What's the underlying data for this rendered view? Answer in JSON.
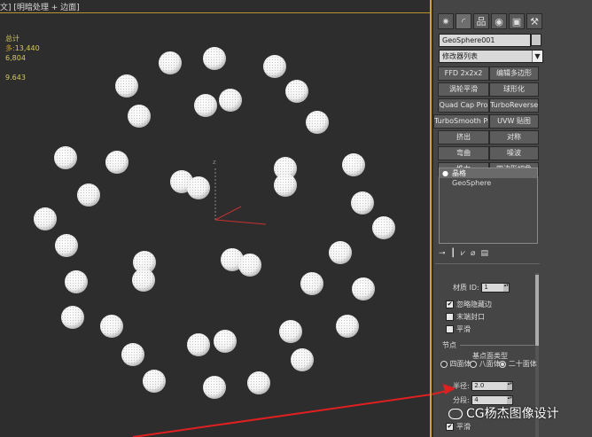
{
  "viewport": {
    "label": "文] [明暗处理 + 边面]",
    "stats_title": "总计",
    "stats_rows": [
      {
        "label": "多:",
        "value": "13,440"
      },
      {
        "label": "",
        "value": "6,804"
      },
      {
        "label": "",
        "value": "9.643"
      }
    ],
    "gizmo_axis_label": "z"
  },
  "panel": {
    "tabs": [
      {
        "icon": "create-icon"
      },
      {
        "icon": "modify-icon"
      },
      {
        "icon": "hierarchy-icon"
      },
      {
        "icon": "motion-icon"
      },
      {
        "icon": "display-icon"
      },
      {
        "icon": "utilities-icon"
      }
    ],
    "object_name": "GeoSphere001",
    "modifier_list": "修改器列表",
    "buttons": [
      "FFD 2x2x2",
      "编辑多边形",
      "涡轮平滑",
      "球形化",
      "Quad Cap Pro",
      "TurboReverse",
      "TurboSmooth Pro",
      "UVW 贴图",
      "挤出",
      "对称",
      "弯曲",
      "噪波",
      "推力",
      "四边形切角"
    ],
    "stack": [
      {
        "label": "晶格",
        "selected": true
      },
      {
        "label": "GeoSphere",
        "selected": false
      }
    ],
    "params": {
      "material_id_label": "材质 ID:",
      "material_id_value": "1",
      "ignore_hidden_label": "忽略隐藏边",
      "cap_ends_label": "末端封口",
      "smooth_label": "平滑",
      "joints_header": "节点",
      "base_type_label": "基点面类型",
      "opt_tetra": "四面体",
      "opt_octa": "八面体",
      "opt_icosa": "二十面体",
      "radius_label": "半径:",
      "radius_value": "2.0",
      "segments_label": "分段:",
      "segments_value": "4",
      "smooth2_label": "平滑"
    }
  },
  "watermark": "CG杨杰图像设计"
}
